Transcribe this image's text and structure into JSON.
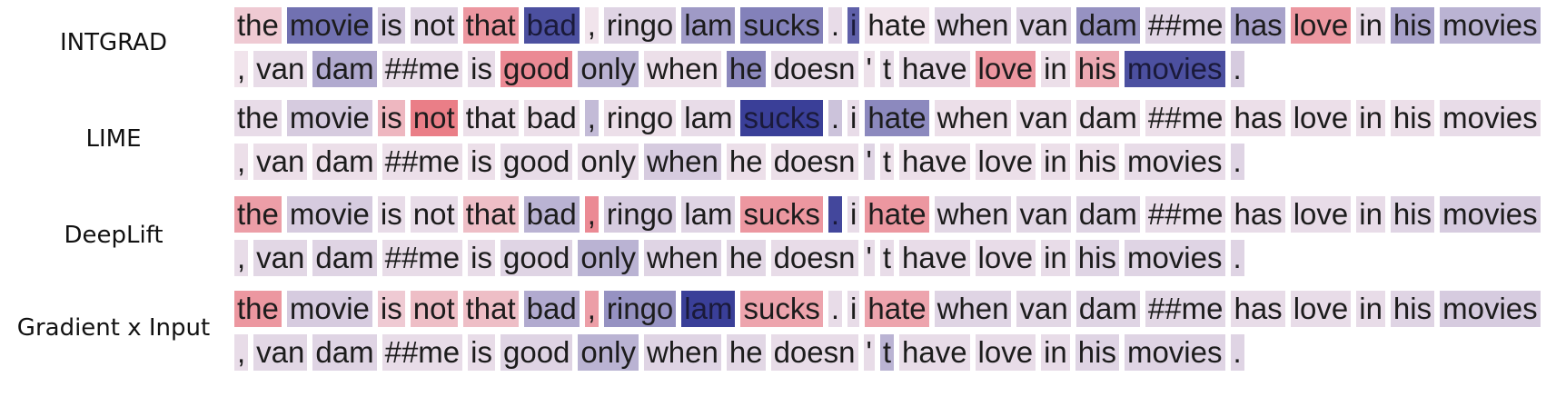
{
  "colors": {
    "positive": "#e8646e",
    "negative": "#3a3f98",
    "neutral": "#f1e4ec"
  },
  "tokens": [
    "the",
    "movie",
    "is",
    "not",
    "that",
    "bad",
    ",",
    "ringo",
    "lam",
    "sucks",
    ".",
    "i",
    "hate",
    "when",
    "van",
    "dam",
    "##me",
    "has",
    "love",
    "in",
    "his",
    "movies",
    ",",
    "van",
    "dam",
    "##me",
    "is",
    "good",
    "only",
    "when",
    "he",
    "doesn",
    "'",
    "t",
    "have",
    "love",
    "in",
    "his",
    "movies",
    "."
  ],
  "methods": [
    {
      "label": "INTGRAD",
      "attributions": [
        0.2,
        -0.7,
        -0.15,
        -0.1,
        0.6,
        -0.9,
        0,
        -0.1,
        -0.45,
        -0.6,
        -0.05,
        -0.8,
        0,
        -0.1,
        -0.12,
        -0.5,
        -0.1,
        -0.4,
        0.6,
        -0.05,
        -0.4,
        -0.3,
        0,
        -0.05,
        -0.35,
        -0.05,
        -0.05,
        0.7,
        -0.3,
        -0.03,
        -0.55,
        -0.05,
        -0.02,
        -0.05,
        -0.05,
        0.6,
        -0.03,
        0.45,
        -0.9,
        -0.15
      ]
    },
    {
      "label": "LIME",
      "attributions": [
        -0.05,
        -0.15,
        0.35,
        0.8,
        -0.03,
        -0.03,
        -0.25,
        -0.03,
        -0.05,
        -1.0,
        -0.2,
        -0.05,
        -0.55,
        -0.03,
        -0.03,
        -0.03,
        -0.03,
        -0.03,
        -0.03,
        -0.03,
        -0.03,
        -0.05,
        -0.03,
        -0.03,
        -0.03,
        -0.03,
        -0.03,
        -0.05,
        -0.05,
        -0.15,
        -0.03,
        -0.03,
        -0.1,
        -0.03,
        -0.03,
        -0.03,
        -0.03,
        -0.03,
        -0.05,
        -0.1
      ]
    },
    {
      "label": "DeepLift",
      "attributions": [
        0.55,
        -0.15,
        -0.05,
        -0.05,
        0.3,
        -0.3,
        0.7,
        -0.15,
        -0.1,
        0.6,
        -0.95,
        -0.05,
        0.6,
        -0.08,
        -0.08,
        -0.1,
        -0.05,
        -0.05,
        -0.05,
        -0.05,
        -0.1,
        -0.15,
        -0.05,
        -0.08,
        -0.1,
        -0.05,
        -0.05,
        -0.1,
        -0.3,
        -0.1,
        -0.08,
        -0.05,
        -0.05,
        -0.05,
        -0.05,
        -0.05,
        -0.05,
        -0.1,
        -0.1,
        -0.1
      ]
    },
    {
      "label": "Gradient x Input",
      "attributions": [
        0.6,
        -0.15,
        0.2,
        0.3,
        0.3,
        -0.35,
        0.55,
        -0.5,
        -1.0,
        0.5,
        -0.05,
        -0.05,
        0.5,
        -0.1,
        -0.08,
        -0.1,
        -0.08,
        -0.05,
        -0.05,
        -0.05,
        -0.1,
        -0.15,
        -0.05,
        -0.08,
        -0.1,
        -0.05,
        -0.05,
        -0.1,
        -0.3,
        -0.1,
        -0.08,
        -0.05,
        -0.05,
        -0.3,
        -0.05,
        -0.05,
        -0.05,
        -0.1,
        -0.1,
        -0.1
      ]
    }
  ]
}
